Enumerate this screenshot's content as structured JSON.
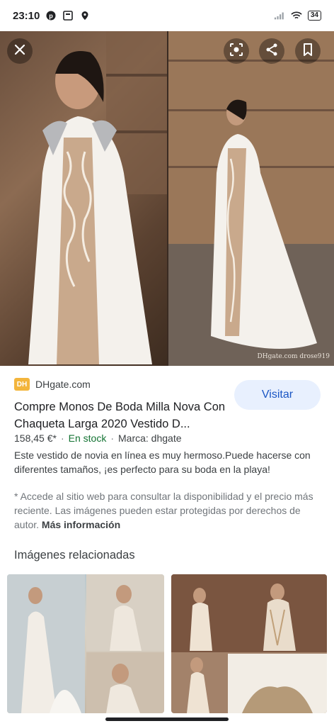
{
  "status_bar": {
    "time": "23:10",
    "battery": "34",
    "left_icons": [
      "pinterest-icon",
      "notification-icon",
      "location-icon"
    ],
    "right_icons": [
      "signal-icon",
      "wifi-icon",
      "battery-icon"
    ]
  },
  "viewer": {
    "watermark": "DHgate.com  drose919",
    "buttons": [
      "close-icon",
      "lens-icon",
      "share-icon",
      "bookmark-icon"
    ]
  },
  "result": {
    "source_name": "DHgate.com",
    "favicon_text": "DH",
    "visit_label": "Visitar",
    "title": "Compre Monos De Boda Milla Nova Con Chaqueta Larga 2020 Vestido D...",
    "price": "158,45 €*",
    "availability": "En stock",
    "brand": "Marca: dhgate",
    "description": "Este vestido de novia en línea es muy hermoso.Puede hacerse con diferentes tamaños, ¡es perfecto para su boda en la playa!",
    "disclaimer": "* Accede al sitio web para consultar la disponibilidad y el precio más reciente. Las imágenes pueden estar protegidas por derechos de autor.",
    "more_info": "Más información",
    "colors": {
      "visit_bg": "#e8f0fe",
      "visit_text": "#1a56c4",
      "stock": "#137333",
      "favicon": "#f3b53c"
    }
  },
  "related": {
    "heading": "Imágenes relacionadas"
  }
}
